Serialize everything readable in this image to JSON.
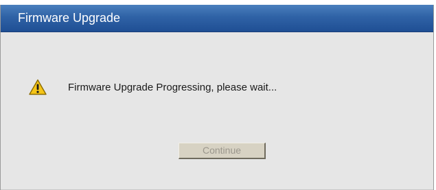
{
  "dialog": {
    "title": "Firmware Upgrade",
    "message": "Firmware Upgrade Progressing, please wait...",
    "icon": "warning-icon",
    "continue_label": "Continue",
    "continue_enabled": false
  },
  "colors": {
    "titlebar": "#2f62a6",
    "dialog_bg": "#e6e6e6",
    "button_bg": "#d7d2c3",
    "warning_yellow": "#f5c518"
  }
}
